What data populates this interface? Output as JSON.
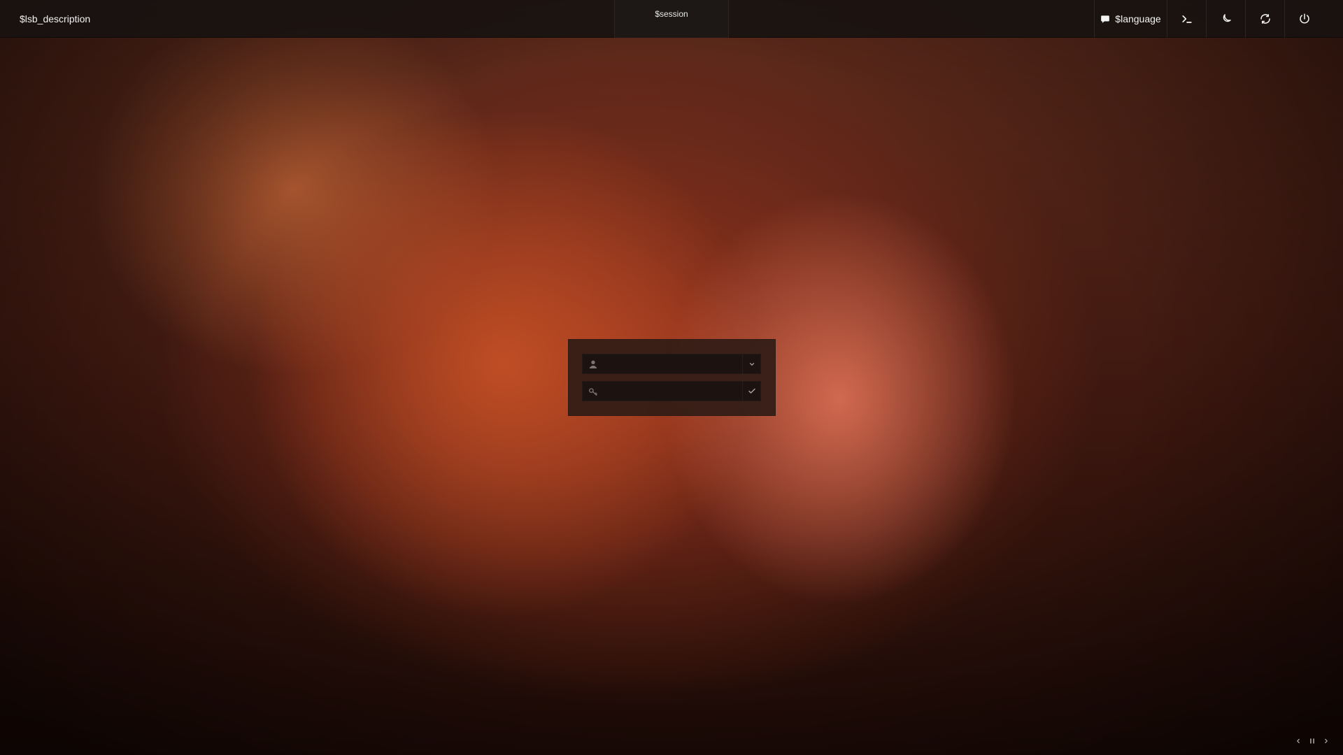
{
  "topbar": {
    "lsb_description": "$lsb_description",
    "session": "$session",
    "language": "$language",
    "icons": {
      "language": "speech-bubble-icon",
      "terminal": "terminal-icon",
      "suspend": "moon-icon",
      "restart": "refresh-icon",
      "power": "power-icon"
    }
  },
  "login": {
    "username": {
      "value": "",
      "placeholder": "",
      "left_icon": "user-icon",
      "right_icon": "chevron-down-icon"
    },
    "password": {
      "value": "",
      "placeholder": "",
      "left_icon": "key-icon",
      "right_icon": "checkmark-icon"
    }
  },
  "slideshow": {
    "icons": {
      "prev": "chevron-left-icon",
      "pause": "pause-icon",
      "next": "chevron-right-icon"
    }
  },
  "colors": {
    "topbar_bg": "#181210",
    "panel_bg": "#301c16",
    "field_bg": "#1c1210",
    "text": "#f2f2f2"
  }
}
